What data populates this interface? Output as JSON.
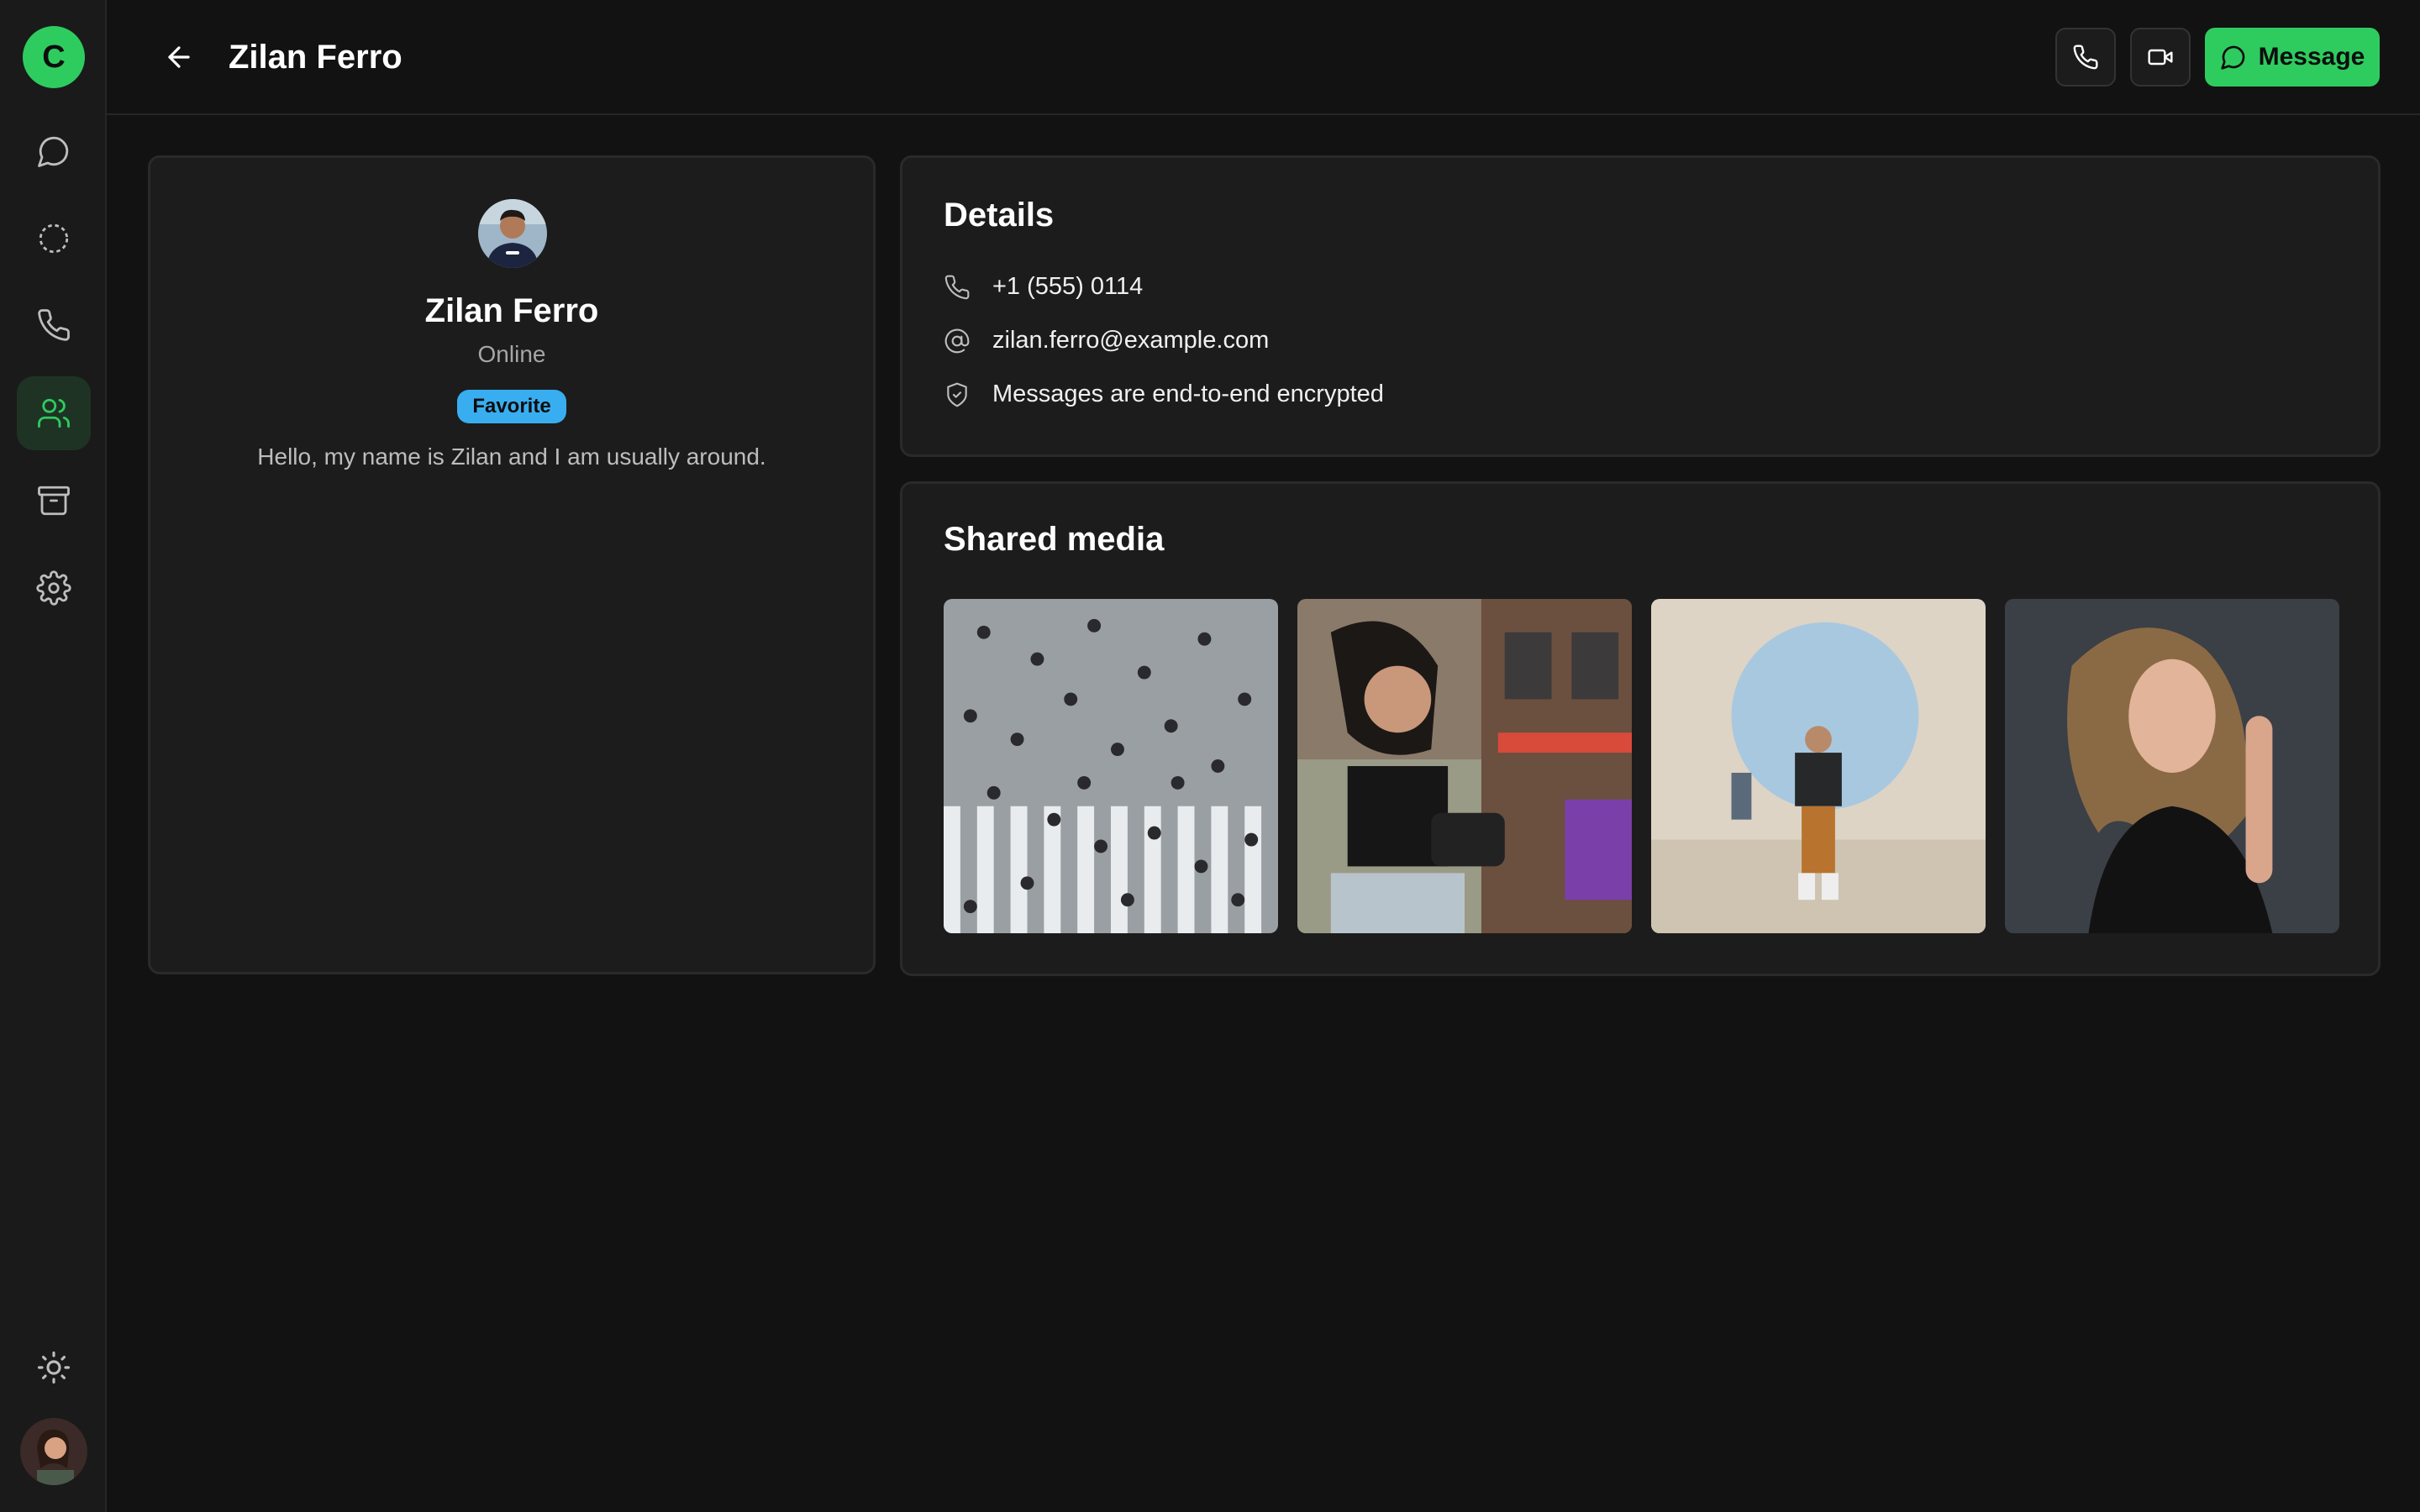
{
  "app": {
    "logo_letter": "C",
    "accent_color": "#2ecc5f"
  },
  "sidebar": {
    "items": [
      {
        "name": "chats",
        "icon": "chat-bubble-icon",
        "active": false
      },
      {
        "name": "status",
        "icon": "dashed-circle-icon",
        "active": false
      },
      {
        "name": "calls",
        "icon": "phone-icon",
        "active": false
      },
      {
        "name": "contacts",
        "icon": "users-icon",
        "active": true
      },
      {
        "name": "archive",
        "icon": "archive-icon",
        "active": false
      },
      {
        "name": "settings",
        "icon": "gear-icon",
        "active": false
      }
    ],
    "theme_toggle_icon": "sun-icon"
  },
  "header": {
    "title": "Zilan Ferro",
    "message_label": "Message"
  },
  "profile": {
    "name": "Zilan Ferro",
    "status": "Online",
    "badge": "Favorite",
    "bio": "Hello, my name is Zilan and I am usually around."
  },
  "details": {
    "title": "Details",
    "phone": "+1 (555) 0114",
    "email": "zilan.ferro@example.com",
    "encryption": "Messages are end-to-end encrypted"
  },
  "shared_media": {
    "title": "Shared media"
  }
}
